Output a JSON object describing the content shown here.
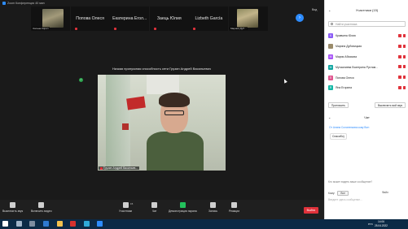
{
  "window": {
    "title": "Zoom Конференция 40 мин",
    "view_label": "Вид"
  },
  "gallery": {
    "tiles": [
      {
        "name": "",
        "tag": "Оксана Кирил",
        "thumb": "cat"
      },
      {
        "name": "Попова Олеся",
        "tag": "",
        "thumb": ""
      },
      {
        "name": "Екатерина Егол...",
        "tag": "",
        "thumb": ""
      },
      {
        "name": "Заець Юлия",
        "tag": "",
        "thumb": ""
      },
      {
        "name": "Lizbeth García",
        "tag": "",
        "thumb": ""
      },
      {
        "name": "",
        "tag": "Марина Дуб...",
        "thumb": "kid"
      }
    ]
  },
  "stage": {
    "weak_connection": "Низкая пропускная способность сети Грузин Андрей Васильевич",
    "speaker_name": "Грузин Андрей Васильев..."
  },
  "toolbar": {
    "mute": "Выключить звук",
    "video": "Включить видео",
    "participants": "Участники",
    "participants_count": "15",
    "chat": "Чат",
    "share": "Демонстрация экрана",
    "record": "Запись",
    "reactions": "Реакции",
    "exit": "Выйти"
  },
  "panel": {
    "title": "Участники (15)",
    "search_placeholder": "Найти участника",
    "participants": [
      {
        "initial": "К",
        "name": "Кравчина Юлия",
        "color": "#8b5cf6"
      },
      {
        "initial": "",
        "name": "Марина Дубовицкая",
        "color": "#9a8b6a"
      },
      {
        "initial": "М",
        "name": "Мария Абхазова",
        "color": "#a855f7"
      },
      {
        "initial": "М",
        "name": "Мутаалиева Екатерина Рустам...",
        "color": "#0ea5a0"
      },
      {
        "initial": "П",
        "name": "Попова Олеся",
        "color": "#e0558f"
      },
      {
        "initial": "Я",
        "name": "Яна Егорина",
        "color": "#14b8a6"
      }
    ],
    "invite_btn": "Пригласить",
    "mute_all_btn": "Выключить мой звук",
    "chat_title": "Чат",
    "chat_from": "От Алина Солоненкова кому Все:",
    "chat_message": "Спасибо)",
    "who_can_see": "Кто может видеть ваше сообщение?",
    "to_label": "Кому:",
    "to_value": "Все",
    "file_label": "Файл",
    "input_placeholder": "Введите здесь сообщение..."
  },
  "taskbar": {
    "lang": "РУС",
    "time": "14:06",
    "date": "25.04.2022"
  }
}
